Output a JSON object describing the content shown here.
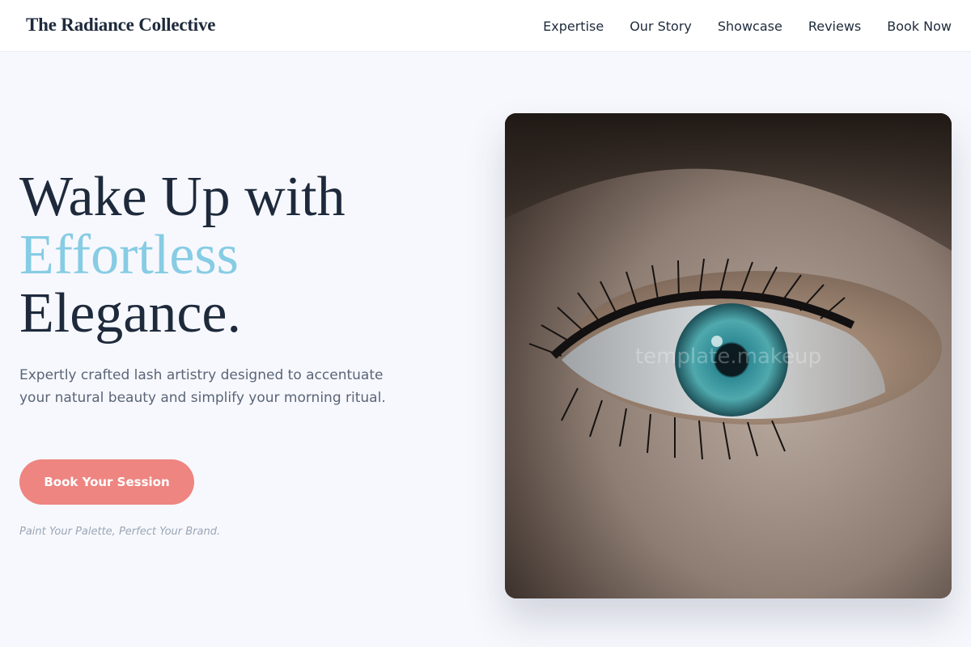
{
  "header": {
    "brand": "The Radiance Collective",
    "nav": [
      "Expertise",
      "Our Story",
      "Showcase",
      "Reviews",
      "Book Now"
    ]
  },
  "hero": {
    "headline_line1": "Wake Up with",
    "headline_accent": "Effortless",
    "headline_line3": "Elegance.",
    "description": "Expertly crafted lash artistry designed to accentuate your natural beauty and simplify your morning ritual.",
    "cta_label": "Book Your Session",
    "tagline": "Paint Your Palette, Perfect Your Brand.",
    "image_watermark": "template.makeup"
  },
  "colors": {
    "accent": "#86cce4",
    "cta": "#ee8580",
    "text": "#1e2a3c",
    "background": "#f7f8fd"
  }
}
